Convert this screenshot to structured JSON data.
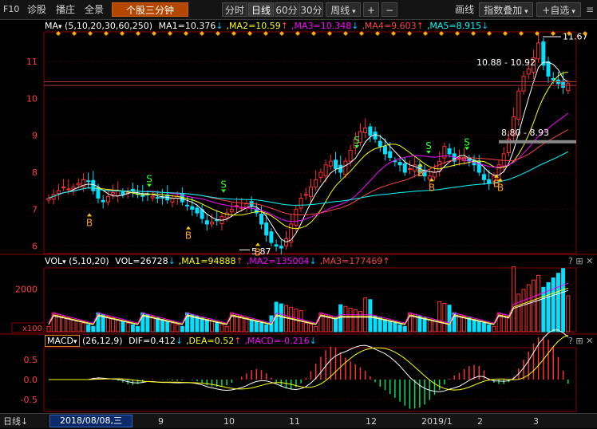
{
  "toolbar": {
    "code": "F10",
    "items": [
      "诊股",
      "播庄",
      "全景"
    ],
    "active_tab": "个股三分钟",
    "periods": [
      "分时",
      "日线",
      "60分",
      "30分"
    ],
    "active_period": "日线",
    "week": "周线",
    "zoom_in": "+",
    "zoom_out": "−",
    "draw": "画线",
    "index_overlay": "指数叠加",
    "watchlist": "+自选"
  },
  "main_panel": {
    "ma_label": "MA",
    "params": "(5,10,20,30,60,250)",
    "ma_values": [
      {
        "label": "MA1=10.376",
        "color": "#ffffff"
      },
      {
        "label": ",MA2=10.59",
        "color": "#ffff00"
      },
      {
        "label": ",MA3=10.348",
        "color": "#ff00ff"
      },
      {
        "label": ",MA4=9.603",
        "color": "#ff4444"
      },
      {
        "label": ",MA5=8.915",
        "color": "#00ffff"
      }
    ],
    "y_ticks": [
      "11",
      "10",
      "9",
      "8",
      "7",
      "6"
    ],
    "annotations": {
      "high": "11.67",
      "range_top": "10.88 - 10.92",
      "range_mid": "8.80 - 8.93",
      "low": "5.87"
    }
  },
  "vol_panel": {
    "label": "VOL",
    "params": "(5,10,20)",
    "values": [
      {
        "label": "VOL=26728",
        "color": "#ffffff"
      },
      {
        "label": ",MA1=94888",
        "color": "#ffff00"
      },
      {
        "label": ",MA2=135004",
        "color": "#ff00ff"
      },
      {
        "label": ",MA3=177469",
        "color": "#ff4444"
      }
    ],
    "y_tick": "2000",
    "unit": "x100"
  },
  "macd_panel": {
    "label": "MACD",
    "params": "(26,12,9)",
    "values": [
      {
        "label": "DIF=0.412",
        "color": "#ffffff"
      },
      {
        "label": ",DEA=0.52",
        "color": "#ffff00"
      },
      {
        "label": ",MACD=-0.216",
        "color": "#ff00ff"
      }
    ],
    "y_ticks": [
      "0.5",
      "0.0",
      "-0.5"
    ]
  },
  "status": {
    "mode": "日线",
    "date": "2018/08/08,三",
    "months": [
      "9",
      "10",
      "11",
      "12",
      "2019/1",
      "2",
      "3"
    ]
  },
  "chart_data": {
    "type": "candlestick",
    "y_range": [
      5.8,
      11.8
    ],
    "ma_legend": [
      "MA1=10.376",
      "MA2=10.59",
      "MA3=10.348",
      "MA4=9.603",
      "MA5=8.915"
    ],
    "close_profile": [
      7.3,
      7.4,
      7.5,
      7.6,
      7.55,
      7.6,
      7.7,
      7.8,
      7.75,
      7.5,
      7.3,
      7.2,
      7.35,
      7.45,
      7.5,
      7.4,
      7.45,
      7.5,
      7.4,
      7.35,
      7.4,
      7.35,
      7.3,
      7.3,
      7.25,
      7.3,
      7.35,
      7.2,
      7.1,
      7.0,
      6.9,
      6.75,
      6.6,
      6.65,
      6.7,
      6.8,
      6.9,
      7.0,
      7.1,
      7.05,
      7.15,
      7.1,
      6.9,
      6.6,
      6.3,
      6.1,
      6.0,
      5.95,
      6.2,
      6.6,
      7.0,
      7.3,
      7.4,
      7.6,
      7.8,
      8.0,
      8.2,
      8.3,
      8.1,
      8.0,
      8.3,
      8.6,
      8.9,
      9.1,
      9.2,
      9.0,
      8.9,
      8.7,
      8.5,
      8.4,
      8.3,
      8.2,
      8.0,
      8.1,
      8.2,
      8.0,
      7.9,
      7.9,
      8.0,
      8.3,
      8.7,
      8.5,
      8.3,
      8.4,
      8.4,
      8.3,
      8.2,
      8.0,
      7.8,
      7.7,
      7.9,
      8.2,
      8.5,
      8.9,
      9.5,
      10.2,
      10.6,
      10.8,
      11.1,
      11.5,
      10.9,
      10.6,
      10.5,
      10.4,
      10.3,
      10.4
    ],
    "signals": [
      "B",
      "S",
      "B",
      "S",
      "B",
      "S",
      "B",
      "S",
      "B",
      "S",
      "B",
      "B"
    ]
  }
}
